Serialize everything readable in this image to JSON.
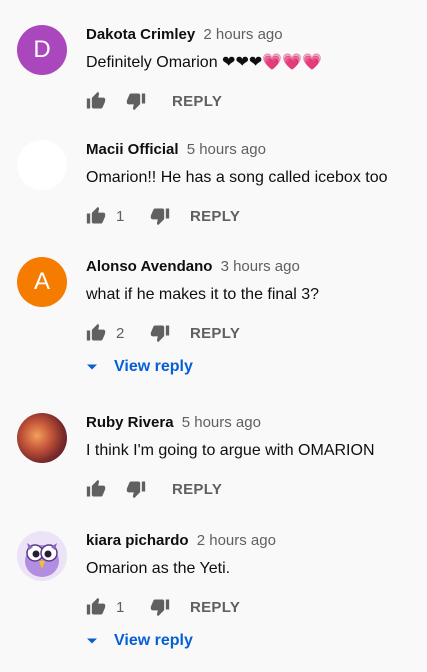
{
  "comments": [
    {
      "author": "Dakota Crimley",
      "time": "2 hours ago",
      "text": "Definitely Omarion ❤❤❤💗💗💗",
      "likes": "",
      "reply_label": "REPLY",
      "avatar_letter": "D",
      "avatar_color": "#ab47bc"
    },
    {
      "author": "Macii Official",
      "time": "5 hours ago",
      "text": "Omarion!! He has a song called icebox too",
      "likes": "1",
      "reply_label": "REPLY",
      "avatar_letter": "",
      "avatar_color": "#ffffff"
    },
    {
      "author": "Alonso Avendano",
      "time": "3 hours ago",
      "text": "what if he makes it to the final 3?",
      "likes": "2",
      "reply_label": "REPLY",
      "avatar_letter": "A",
      "avatar_color": "#f57c00",
      "view_reply": "View reply"
    },
    {
      "author": "Ruby Rivera",
      "time": "5 hours ago",
      "text": "I think I'm going to argue with OMARION",
      "likes": "",
      "reply_label": "REPLY",
      "avatar_letter": "",
      "avatar_color": "#8d3a2a"
    },
    {
      "author": "kiara pichardo",
      "time": "2 hours ago",
      "text": "Omarion as the Yeti.",
      "likes": "1",
      "reply_label": "REPLY",
      "avatar_letter": "",
      "avatar_color": "#d9c8f0",
      "view_reply": "View reply"
    }
  ],
  "colors": {
    "link": "#065fd4",
    "secondary_text": "#606060",
    "background": "#f9f9f9"
  },
  "icons": {
    "like": "thumbs-up-icon",
    "dislike": "thumbs-down-icon",
    "expand": "caret-down-icon"
  }
}
